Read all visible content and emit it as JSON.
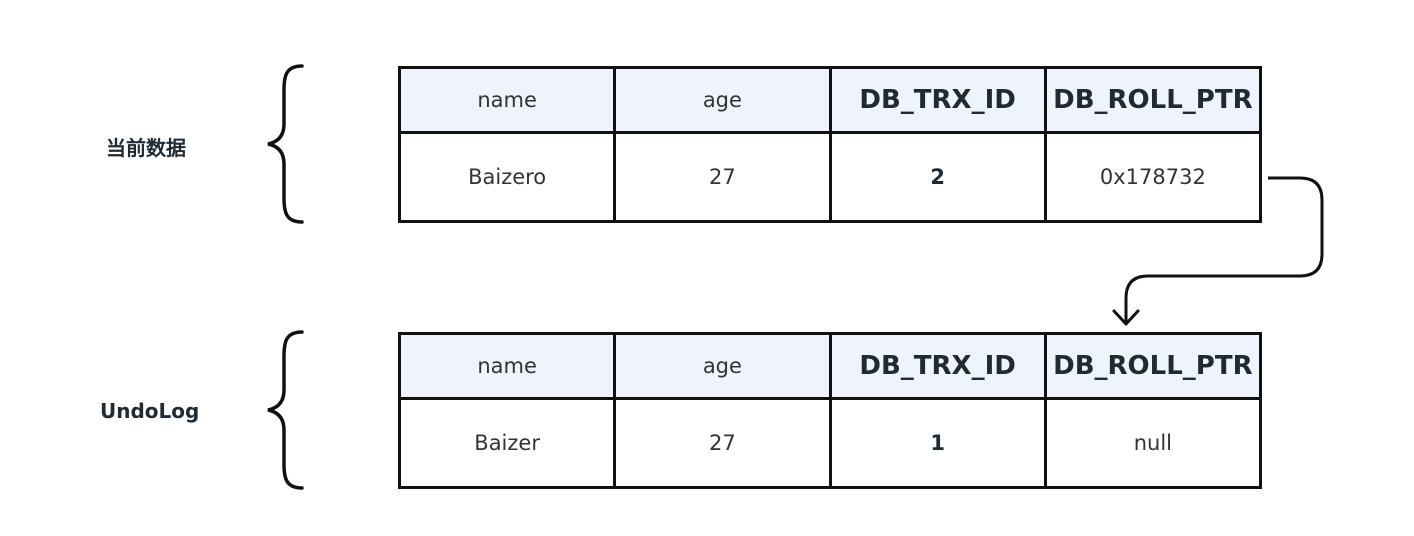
{
  "current": {
    "label": "当前数据",
    "headers": [
      "name",
      "age",
      "DB_TRX_ID",
      "DB_ROLL_PTR"
    ],
    "values": [
      "Baizero",
      "27",
      "2",
      "0x178732"
    ]
  },
  "undo": {
    "label": "UndoLog",
    "headers": [
      "name",
      "age",
      "DB_TRX_ID",
      "DB_ROLL_PTR"
    ],
    "values": [
      "Baizer",
      "27",
      "1",
      "null"
    ]
  }
}
